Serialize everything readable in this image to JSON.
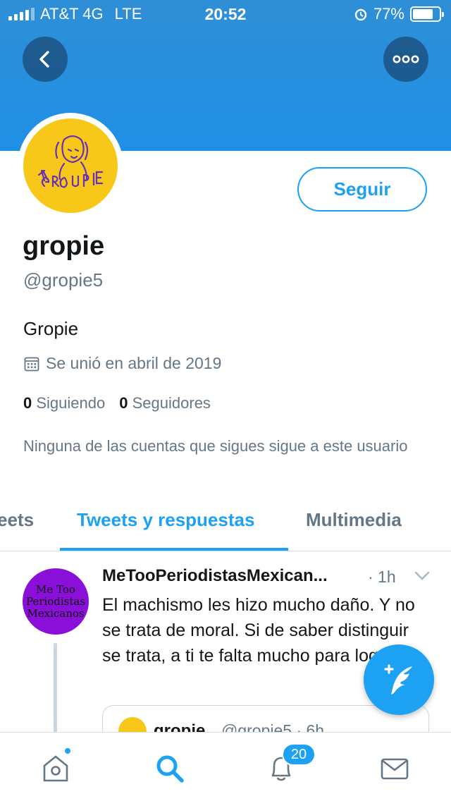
{
  "status_bar": {
    "carrier": "AT&T 4G",
    "network": "LTE",
    "time": "20:52",
    "battery_level": "77%",
    "battery_fraction": 0.77
  },
  "header": {
    "back_icon": "chevron-left-icon",
    "more_icon": "more-dots-icon",
    "banner_color": "#1f8fe6"
  },
  "profile": {
    "avatar_icon": "la-groupie-logo",
    "follow_label": "Seguir",
    "display_name": "gropie",
    "handle": "@gropie5",
    "bio": "Gropie",
    "joined": "Se unió en abril de 2019",
    "following_count": "0",
    "following_label": "Siguiendo",
    "followers_count": "0",
    "followers_label": "Seguidores",
    "followers_note": "Ninguna de las cuentas que sigues sigue a este usuario"
  },
  "tabs": [
    {
      "label": "eets"
    },
    {
      "label": "Tweets y respuestas",
      "active": true
    },
    {
      "label": "Multimedia"
    }
  ],
  "tweet": {
    "avatar_lines": [
      "Me Too",
      "Periodistas",
      "Mexicanos"
    ],
    "author": "MeTooPeriodistasMexican...",
    "time": "· 1h",
    "text": "El machismo les hizo mucho daño. Y no se trata de moral. Si de saber distinguir se trata, a ti te falta mucho para lograrlo.",
    "quote": {
      "name": "gropie",
      "handle_time": "@gropie5 · 6h"
    }
  },
  "bottom_nav": {
    "items": [
      "home-icon",
      "search-icon",
      "notifications-icon",
      "messages-icon"
    ],
    "notification_count": "20",
    "accent": "#1da1f2"
  }
}
